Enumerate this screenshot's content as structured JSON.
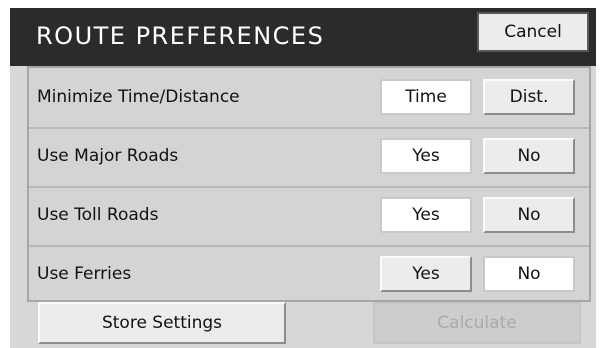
{
  "header": {
    "title": "ROUTE PREFERENCES",
    "cancel_label": "Cancel"
  },
  "rows": [
    {
      "label": "Minimize Time/Distance",
      "option_a": "Time",
      "option_b": "Dist.",
      "selected": "Time"
    },
    {
      "label": "Use Major Roads",
      "option_a": "Yes",
      "option_b": "No",
      "selected": "Yes"
    },
    {
      "label": "Use Toll Roads",
      "option_a": "Yes",
      "option_b": "No",
      "selected": "Yes"
    },
    {
      "label": "Use Ferries",
      "option_a": "Yes",
      "option_b": "No",
      "selected": "No"
    }
  ],
  "footer": {
    "store_label": "Store Settings",
    "calculate_label": "Calculate",
    "calculate_state": "disabled"
  },
  "colors": {
    "titlebar": "#2b2b2b",
    "background": "#d7d7d7",
    "selected_button": "#ffffff",
    "button": "#ececec"
  }
}
